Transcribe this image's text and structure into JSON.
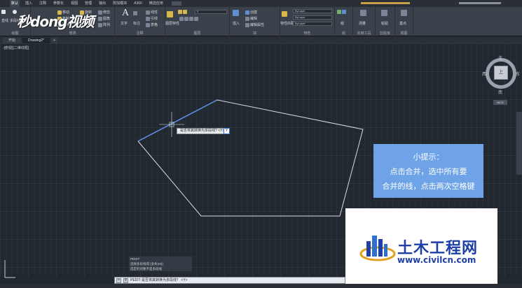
{
  "ribbon_tabs": [
    "默认",
    "插入",
    "注释",
    "参数化",
    "视图",
    "管理",
    "输出",
    "附加模块",
    "A360",
    "精选应用"
  ],
  "active_tab_index": 0,
  "ribbon": {
    "draw_tools": [
      "直线",
      "多段线",
      "圆",
      "圆弧"
    ],
    "modify_tools": [
      "移动",
      "旋转",
      "修剪",
      "复制",
      "镜像",
      "圆角",
      "拉伸",
      "缩放",
      "阵列"
    ],
    "annotation_tools": [
      "文字",
      "标注",
      "线性",
      "引线",
      "表格"
    ],
    "layer_combo": "0",
    "layer_tools": [
      "图层特性"
    ],
    "block_tools": [
      "插入",
      "创建",
      "编辑",
      "编辑属性"
    ],
    "properties_tools": [
      "特性匹配"
    ],
    "bylayer_1": "ByLayer",
    "bylayer_2": "ByLayer",
    "bylayer_3": "ByLayer",
    "groups_tools": [
      "组"
    ],
    "utilities_tools": [
      "测量"
    ],
    "clipboard_tools": [
      "粘贴"
    ],
    "view_tools": [
      "基点"
    ],
    "panels": [
      "绘图",
      "修改",
      "注释",
      "图层",
      "块",
      "特性",
      "组",
      "实用工具",
      "剪贴板",
      "视图"
    ]
  },
  "logo_text": "秒dong视频",
  "file_tabs": [
    "开始",
    "Drawing2*",
    "+"
  ],
  "viewport_label": "-[俯视][二维线框]",
  "viewcube": {
    "north": "北",
    "south": "南",
    "east": "东",
    "west": "西",
    "face": "上",
    "wcs": "WCS"
  },
  "tooltip": {
    "prompt": "是否将其转换为多段线? <Y>",
    "input_value": "Y"
  },
  "hint": {
    "title": "小提示：",
    "line1": "点击合并，选中所有要",
    "line2": "合并的线，点击两次空格键"
  },
  "brand": {
    "name": "土木工程网",
    "url": "www.civilcn.com"
  },
  "command_history": [
    "PEDIT",
    "选择多段线或 [多条(M)]:",
    "选定的对象不是多段线"
  ],
  "command_line": "PEDIT 是否将其转换为多段线？ <Y>",
  "colors": {
    "canvas": "#212830",
    "polygon": "#d8dde3",
    "highlight": "#5f8fe8",
    "hint_bg": "#6ea3e8",
    "brand_blue": "#1e3fa8"
  }
}
